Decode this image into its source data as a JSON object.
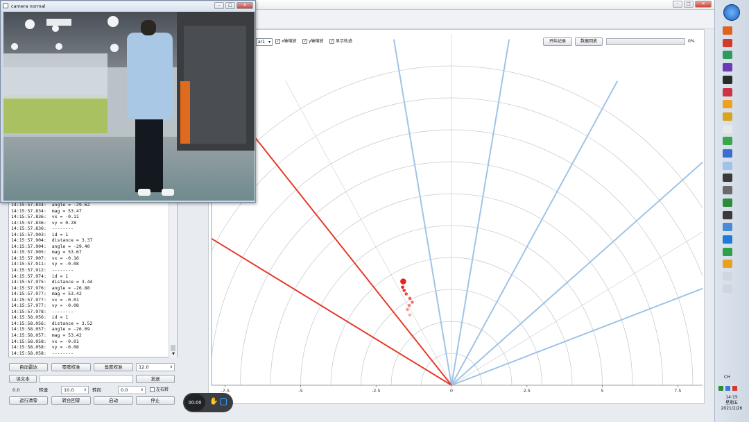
{
  "camera_window": {
    "title": "camera normal"
  },
  "toolbar": {
    "select_value": "ar1",
    "x_zoom_label": "x轴缩放",
    "y_zoom_label": "y轴缩放",
    "show_track_label": "显示轨迹",
    "start_record_label": "开始记录",
    "data_replay_label": "数据回放",
    "progress_text": "0%"
  },
  "progress": {
    "value": 0
  },
  "log_lines": [
    "14:15:57.834:  angle = -29.62",
    "14:15:57.834:  mag = 53.47",
    "14:15:57.836:  vx = -0.11",
    "14:15:57.836:  vy = 0.28",
    "14:15:57.836:  --------",
    "14:15:57.903:  id = 1",
    "14:15:57.904:  distance = 3.37",
    "14:15:57.904:  angle = -29.40",
    "14:15:57.905:  mag = 53.67",
    "14:15:57.907:  vx = -0.16",
    "14:15:57.911:  vy = -0.08",
    "14:15:57.912:  --------",
    "14:15:57.974:  id = 1",
    "14:15:57.975:  distance = 3.44",
    "14:15:57.976:  angle = -26.88",
    "14:15:57.977:  mag = 53.42",
    "14:15:57.977:  vx = -0.01",
    "14:15:57.977:  vy = -0.08",
    "14:15:57.978:  --------",
    "14:15:58.056:  id = 1",
    "14:15:58.056:  distance = 3.52",
    "14:15:58.057:  angle = -26.09",
    "14:15:58.057:  mag = 53.42",
    "14:15:58.058:  vx = -0.01",
    "14:15:58.058:  vy = -0.08",
    "14:15:58.058:  --------"
  ],
  "controls": {
    "auto_radar_label": "自动雷达",
    "zero_calib_label": "零度校准",
    "angle_calib_label": "角度校准",
    "angle_value": "12.0",
    "read_text_label": "读文本",
    "send_label": "发送",
    "v1_value": "0.0",
    "speed_label": "转速",
    "speed_value": "10.0",
    "dir_label": "转向",
    "dir_value": "0.0",
    "lr_turn_label": "左右转",
    "run_clear_label": "运行清零",
    "turntable_return_label": "转台回零",
    "start_label": "启动",
    "stop_label": "停止"
  },
  "recorder": {
    "time": "00:00"
  },
  "taskbar": {
    "time": "14:15",
    "weekday": "星期五",
    "date": "2021/2/26",
    "lang": "CH"
  },
  "colors": {
    "boundary": "#e53a2a",
    "beam": "#9fc3e6",
    "target": "#e8231e",
    "grid": "#c9ccd1"
  },
  "chart_data": {
    "type": "scatter",
    "x_ticks": [
      "-7.5",
      "-5",
      "-2.5",
      "0",
      "2.5",
      "5",
      "7.5"
    ],
    "y_ticks": [
      "0",
      "1.5",
      "3",
      "4.5"
    ],
    "xlim": [
      -8,
      8
    ],
    "ylim": [
      0,
      10.6
    ],
    "range_rings": [
      1,
      2,
      3,
      4,
      5,
      6,
      7,
      8,
      9,
      10
    ],
    "boundary_angles_deg": [
      -60,
      -40
    ],
    "beam_angles_deg": [
      -10,
      10,
      30,
      50,
      70
    ],
    "target": {
      "x": -1.6,
      "y": 3.25
    },
    "trail": [
      {
        "x": -1.62,
        "y": 3.07
      },
      {
        "x": -1.57,
        "y": 2.97
      },
      {
        "x": -1.5,
        "y": 2.86
      },
      {
        "x": -1.38,
        "y": 2.72
      },
      {
        "x": -1.3,
        "y": 2.6
      },
      {
        "x": -1.4,
        "y": 2.5
      },
      {
        "x": -1.46,
        "y": 2.37
      },
      {
        "x": -1.38,
        "y": 2.2
      }
    ]
  }
}
